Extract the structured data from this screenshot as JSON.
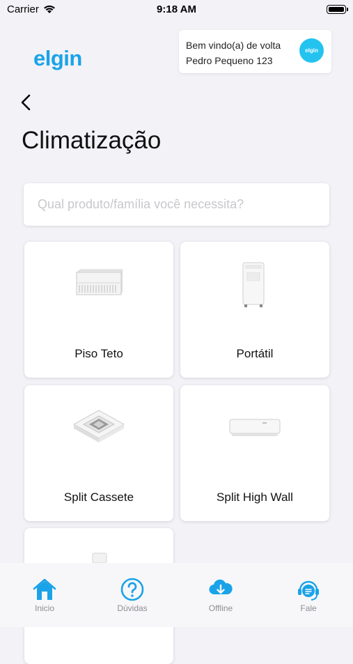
{
  "status_bar": {
    "carrier": "Carrier",
    "time": "9:18 AM"
  },
  "header": {
    "logo": "elgin",
    "welcome_line1": "Bem vindo(a) de volta",
    "welcome_line2": "Pedro Pequeno 123",
    "avatar_text": "elgin"
  },
  "page": {
    "title": "Climatização"
  },
  "search": {
    "placeholder": "Qual produto/família você necessita?"
  },
  "products": [
    {
      "label": "Piso Teto",
      "icon": "floor-ceiling-ac"
    },
    {
      "label": "Portátil",
      "icon": "portable-ac"
    },
    {
      "label": "Split Cassete",
      "icon": "cassette-ac"
    },
    {
      "label": "Split High Wall",
      "icon": "wall-split-ac"
    }
  ],
  "tab_bar": [
    {
      "label": "Inicio",
      "icon": "home-icon"
    },
    {
      "label": "Dúvidas",
      "icon": "question-icon"
    },
    {
      "label": "Offline",
      "icon": "cloud-download-icon"
    },
    {
      "label": "Fale",
      "icon": "headset-icon"
    }
  ],
  "colors": {
    "accent": "#1aa3e8",
    "background": "#f2f2f7"
  }
}
